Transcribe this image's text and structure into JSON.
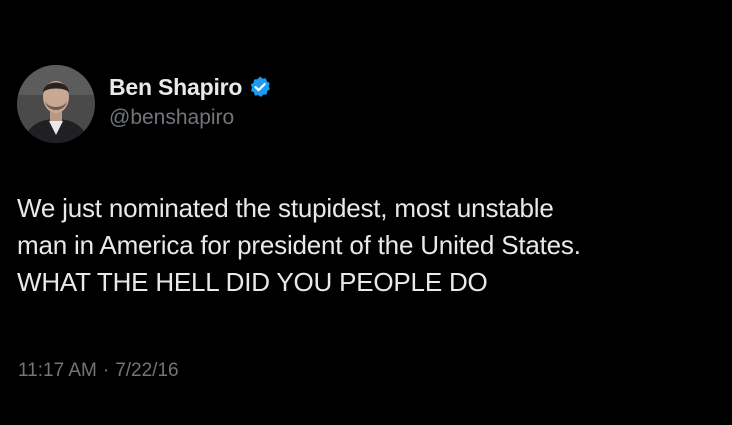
{
  "author": {
    "display_name": "Ben Shapiro",
    "handle": "@benshapiro",
    "verified": true,
    "verified_badge_color": "#1d9bf0"
  },
  "tweet": {
    "lines": [
      "We just nominated the stupidest, most unstable",
      "man in America for president of the United States.",
      "WHAT THE HELL DID YOU PEOPLE DO"
    ],
    "time": "11:17 AM",
    "separator": "·",
    "date": "7/22/16"
  },
  "colors": {
    "background": "#000000",
    "primary_text": "#e7e9ea",
    "secondary_text": "#71767b"
  }
}
